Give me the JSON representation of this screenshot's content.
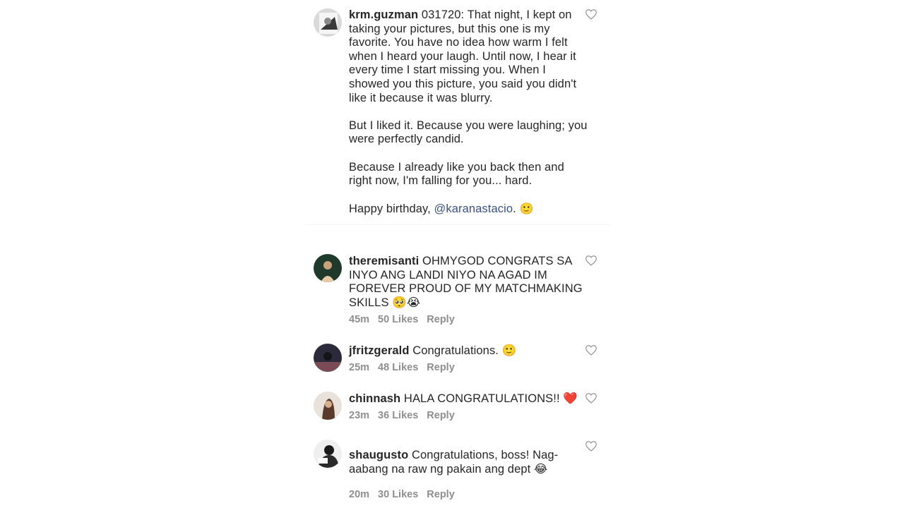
{
  "caption": {
    "username": "krm.guzman",
    "first_line": "031720: That night, I kept on taking your pictures, but this one is my favorite. You have no idea how warm I felt when I heard your laugh. Until now, I hear it every time I start missing you. When I showed you this picture, you said you didn't like it because it was blurry.",
    "para2": "But I liked it. Because you were laughing; you were perfectly candid.",
    "para3": "Because I already like you back then and right now, I'm falling for you... hard.",
    "para4_prefix": "Happy birthday, ",
    "mention": "@karanastacio",
    "para4_suffix": ". ",
    "emoji": "🙂",
    "like_icon": "heart-outline-icon"
  },
  "comments": [
    {
      "username": "theremisanti",
      "text": "OHMYGOD CONGRATS SA INYO ANG LANDI NIYO NA AGAD IM FOREVER PROUD OF MY MATCHMAKING SKILLS 🥺😭",
      "time": "45m",
      "likes": "50 Likes",
      "reply": "Reply"
    },
    {
      "username": "jfritzgerald",
      "text": "Congratulations. 🙂",
      "time": "25m",
      "likes": "48 Likes",
      "reply": "Reply"
    },
    {
      "username": "chinnash",
      "text": "HALA CONGRATULATIONS!! ❤️",
      "time": "23m",
      "likes": "36 Likes",
      "reply": "Reply"
    },
    {
      "username": "shaugusto",
      "text": "Congratulations, boss! Nag-aabang na raw ng pakain ang dept 😂",
      "time": "20m",
      "likes": "30 Likes",
      "reply": "Reply"
    }
  ],
  "colors": {
    "text": "#262626",
    "meta": "#8e8e8e",
    "mention": "#385185"
  }
}
